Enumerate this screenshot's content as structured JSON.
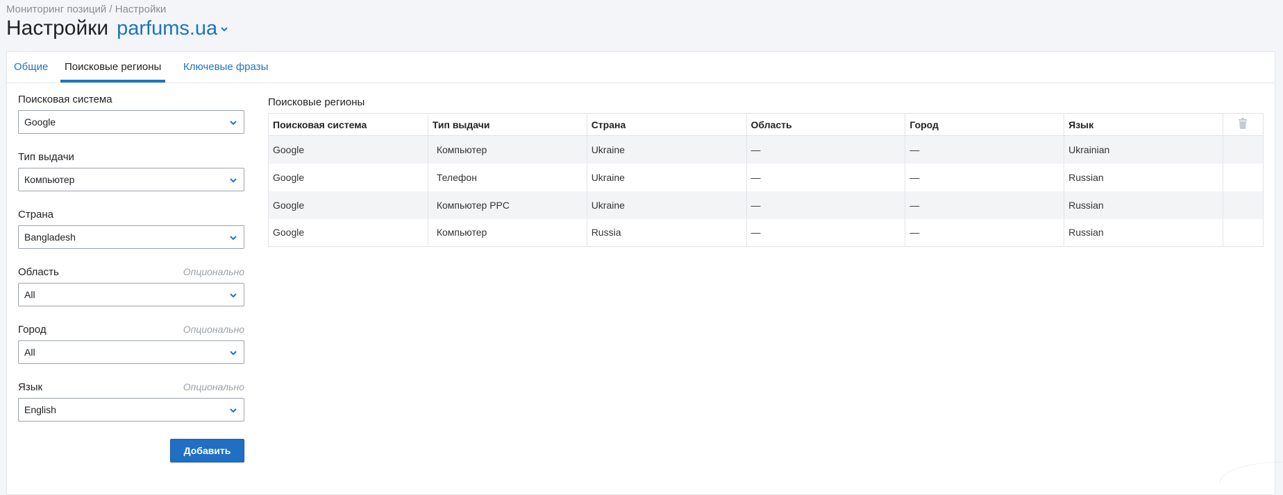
{
  "breadcrumb": "Мониторинг позиций / Настройки",
  "header": {
    "title": "Настройки",
    "project": "parfums.ua"
  },
  "tabs": [
    {
      "label": "Общие",
      "active": false
    },
    {
      "label": "Поисковые регионы",
      "active": true
    },
    {
      "label": "Ключевые фразы",
      "active": false
    }
  ],
  "form": {
    "search_engine": {
      "label": "Поисковая система",
      "value": "Google"
    },
    "result_type": {
      "label": "Тип выдачи",
      "value": "Компьютер"
    },
    "country": {
      "label": "Страна",
      "value": "Bangladesh"
    },
    "region": {
      "label": "Область",
      "optional": "Опционально",
      "value": "All"
    },
    "city": {
      "label": "Город",
      "optional": "Опционально",
      "value": "All"
    },
    "language": {
      "label": "Язык",
      "optional": "Опционально",
      "value": "English"
    },
    "add_button": "Добавить"
  },
  "regions": {
    "title": "Поисковые регионы",
    "columns": [
      "Поисковая система",
      "Тип выдачи",
      "Страна",
      "Область",
      "Город",
      "Язык"
    ],
    "rows": [
      [
        "Google",
        "Компьютер",
        "Ukraine",
        "—",
        "—",
        "Ukrainian"
      ],
      [
        "Google",
        "Телефон",
        "Ukraine",
        "—",
        "—",
        "Russian"
      ],
      [
        "Google",
        "Компьютер PPC",
        "Ukraine",
        "—",
        "—",
        "Russian"
      ],
      [
        "Google",
        "Компьютер",
        "Russia",
        "—",
        "—",
        "Russian"
      ]
    ]
  },
  "colors": {
    "accent": "#1e74bf",
    "button": "#1f6fc4",
    "background": "#f3f5f8"
  },
  "icons": {
    "select_arrow": "chevron-down-icon",
    "delete": "trash-icon"
  }
}
